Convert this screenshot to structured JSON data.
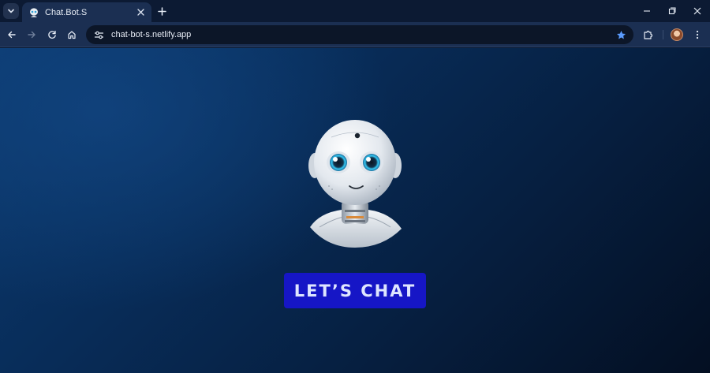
{
  "browser": {
    "tab": {
      "title": "Chat.Bot.S",
      "favicon_icon": "robot-favicon"
    },
    "address_bar": {
      "url": "chat-bot-s.netlify.app"
    },
    "icons": {
      "tab_search": "chevron-down-icon",
      "new_tab": "plus-icon",
      "minimize": "minimize-icon",
      "restore": "restore-icon",
      "close": "close-icon",
      "back": "arrow-left-icon",
      "forward": "arrow-right-icon",
      "reload": "reload-icon",
      "home": "home-icon",
      "site_info": "tune-icon",
      "bookmark": "star-icon",
      "extensions": "puzzle-icon",
      "profile": "avatar",
      "menu": "kebab-menu-icon"
    },
    "colors": {
      "bookmark_star": "#5b9cff"
    }
  },
  "page": {
    "cta_label": "LET’S CHAT",
    "colors": {
      "cta_background": "#1616c6",
      "cta_text": "#dfe6ff",
      "background_light": "#0b3a70",
      "background_dark": "#040f22"
    }
  }
}
